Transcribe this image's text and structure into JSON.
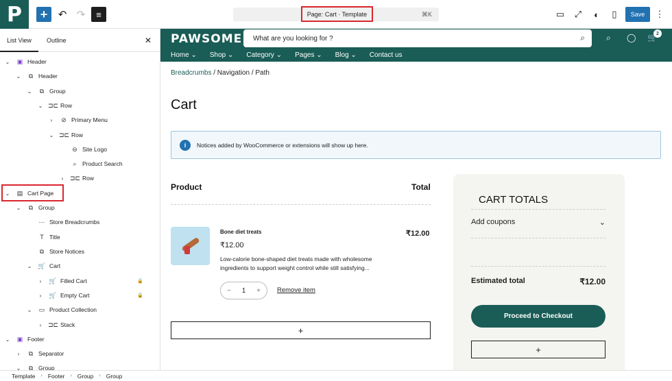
{
  "toolbar": {
    "logo_letter": "P",
    "add_icon": "+",
    "undo_icon": "↶",
    "redo_icon": "↷",
    "list_icon": "≡",
    "command_title": "Page: Cart · Template",
    "command_shortcut": "⌘K",
    "view_icon": "▭",
    "zoom_icon": "⤢",
    "style_icon": "◐",
    "settings_icon": "▯",
    "save_label": "Save",
    "more_icon": "⋮"
  },
  "sidebar": {
    "tab_list": "List View",
    "tab_outline": "Outline",
    "close_icon": "✕",
    "nodes": [
      {
        "label": "Header",
        "chev": "⌄",
        "icon": "▣",
        "indent": 0,
        "purple": true
      },
      {
        "label": "Header",
        "chev": "⌄",
        "icon": "⧉",
        "indent": 1
      },
      {
        "label": "Group",
        "chev": "⌄",
        "icon": "⧉",
        "indent": 2
      },
      {
        "label": "Row",
        "chev": "⌄",
        "icon": "⊐⊏",
        "indent": 3
      },
      {
        "label": "Primary Menu",
        "chev": "›",
        "icon": "⊘",
        "indent": 4
      },
      {
        "label": "Row",
        "chev": "⌄",
        "icon": "⊐⊏",
        "indent": 4
      },
      {
        "label": "Site Logo",
        "chev": "",
        "icon": "⊖",
        "indent": 5
      },
      {
        "label": "Product Search",
        "chev": "",
        "icon": "⌕",
        "indent": 5
      },
      {
        "label": "Row",
        "chev": "›",
        "icon": "⊐⊏",
        "indent": 5
      },
      {
        "label": "Cart Page",
        "chev": "⌄",
        "icon": "▤",
        "indent": 0
      },
      {
        "label": "Group",
        "chev": "⌄",
        "icon": "⧉",
        "indent": 1
      },
      {
        "label": "Store Breadcrumbs",
        "chev": "",
        "icon": "⋯",
        "indent": 2
      },
      {
        "label": "Title",
        "chev": "",
        "icon": "T",
        "indent": 2
      },
      {
        "label": "Store Notices",
        "chev": "",
        "icon": "⧉",
        "indent": 2
      },
      {
        "label": "Cart",
        "chev": "⌄",
        "icon": "🛒",
        "indent": 2
      },
      {
        "label": "Filled Cart",
        "chev": "›",
        "icon": "🛒",
        "indent": 3,
        "lock": "🔒"
      },
      {
        "label": "Empty Cart",
        "chev": "›",
        "icon": "🛒",
        "indent": 3,
        "lock": "🔒"
      },
      {
        "label": "Product Collection",
        "chev": "⌄",
        "icon": "▭",
        "indent": 2
      },
      {
        "label": "Stack",
        "chev": "›",
        "icon": "⊐⊏",
        "indent": 3
      },
      {
        "label": "Footer",
        "chev": "⌄",
        "icon": "▣",
        "indent": 0,
        "purple": true
      },
      {
        "label": "Separator",
        "chev": "›",
        "icon": "⧉",
        "indent": 1
      },
      {
        "label": "Group",
        "chev": "⌄",
        "icon": "⧉",
        "indent": 1
      }
    ]
  },
  "statusbar": [
    "Template",
    "Footer",
    "Group",
    "Group"
  ],
  "site": {
    "brand": "PAWSOME",
    "search_placeholder": "What are you looking for ?",
    "cart_count": "2",
    "nav": [
      "Home ⌄",
      "Shop ⌄",
      "Category ⌄",
      "Pages ⌄",
      "Blog ⌄",
      "Contact us"
    ],
    "breadcrumb_link": "Breadcrumbs",
    "breadcrumb_rest": " / Navigation / Path",
    "page_title": "Cart",
    "notice": "Notices added by WooCommerce or extensions will show up here.",
    "col_product": "Product",
    "col_total": "Total",
    "item": {
      "name": "Bone diet treats",
      "price": "₹12.00",
      "description": "Low-calorie bone-shaped diet treats made with wholesome ingredients to support weight control while still satisfying...",
      "total": "₹12.00",
      "qty": "1",
      "minus": "−",
      "plus": "+",
      "remove": "Remove item"
    },
    "add_icon": "+",
    "totals": {
      "heading": "CART TOTALS",
      "coupons": "Add coupons",
      "coupons_icon": "⌄",
      "estimated_label": "Estimated total",
      "estimated_value": "₹12.00",
      "checkout": "Proceed to Checkout"
    }
  },
  "colors": {
    "brand": "#1a5c56",
    "accent": "#2271b1",
    "highlight": "#d9262e"
  }
}
